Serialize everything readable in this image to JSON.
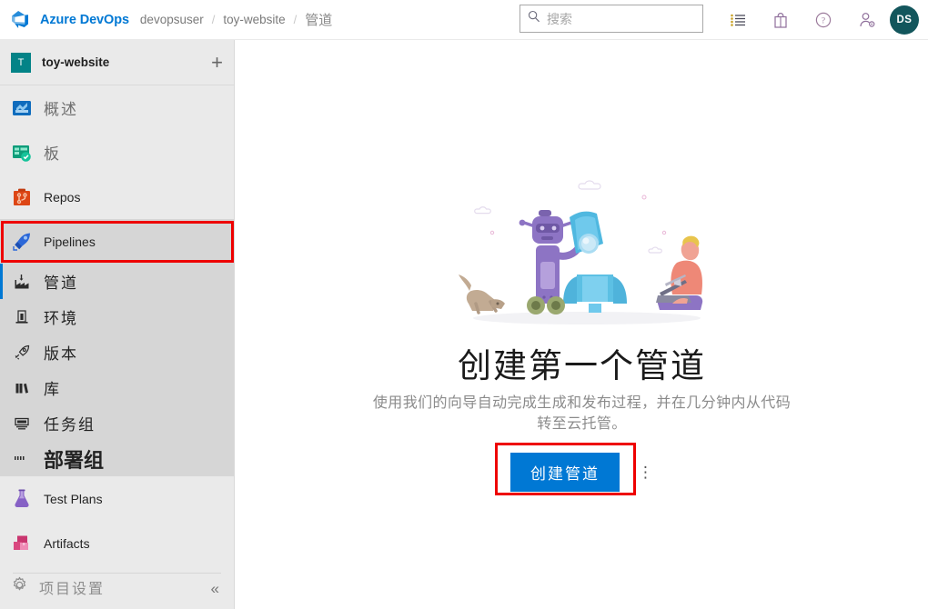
{
  "topbar": {
    "logo_icon": "azure-devops-logo-icon",
    "brand": "Azure DevOps",
    "breadcrumb": [
      {
        "label": "devopsuser"
      },
      {
        "label": "toy-website"
      },
      {
        "label": "管道"
      }
    ],
    "separator": "/",
    "search": {
      "placeholder": "搜索",
      "value": "",
      "icon": "search-icon"
    },
    "icons": [
      {
        "name": "backlog-list-icon"
      },
      {
        "name": "marketplace-bag-icon"
      },
      {
        "name": "help-question-icon"
      },
      {
        "name": "user-settings-icon"
      }
    ],
    "avatar_initials": "DS"
  },
  "sidebar": {
    "project": {
      "avatar_letter": "T",
      "name": "toy-website",
      "add_label": "+"
    },
    "items": [
      {
        "label": "概述",
        "icon": "overview-icon",
        "cn": true
      },
      {
        "label": "板",
        "icon": "boards-icon",
        "cn": true
      },
      {
        "label": "Repos",
        "icon": "repos-icon",
        "cn": false
      },
      {
        "label": "Pipelines",
        "icon": "pipelines-icon",
        "cn": false,
        "highlighted": true
      }
    ],
    "subitems": [
      {
        "label": "管道",
        "icon": "pipelines-factory-icon",
        "active": true
      },
      {
        "label": "环境",
        "icon": "environments-icon",
        "active": false
      },
      {
        "label": "版本",
        "icon": "releases-rocket-icon",
        "active": false
      },
      {
        "label": "库",
        "icon": "library-books-icon",
        "active": false
      },
      {
        "label": "任务组",
        "icon": "task-groups-icon",
        "active": false
      },
      {
        "label": "部署组",
        "icon": "deployment-groups-icon",
        "active": false,
        "emphasized": true
      }
    ],
    "items_bottom": [
      {
        "label": "Test Plans",
        "icon": "test-plans-flask-icon"
      },
      {
        "label": "Artifacts",
        "icon": "artifacts-boxes-icon"
      }
    ],
    "project_settings": {
      "label": "项目设置",
      "icon": "gear-icon"
    },
    "collapse": {
      "label": "«",
      "icon": "chevron-double-left-icon"
    }
  },
  "main": {
    "illustration_name": "robot-rocket-illustration",
    "title": "创建第一个管道",
    "description": "使用我们的向导自动完成生成和发布过程，并在几分钟内从代码转至云托管。",
    "create_button": "创建管道",
    "more_actions": "⋮"
  },
  "annotations": {
    "highlight_color": "#ee0000",
    "boxes": [
      "pipelines-nav-item",
      "create-pipeline-button"
    ]
  },
  "colors": {
    "accent": "#0078d4",
    "sidebar_bg": "#eaeaea",
    "subnav_bg": "#d6d6d6",
    "avatar_bg": "#13565c",
    "project_avatar_bg": "#038387"
  }
}
